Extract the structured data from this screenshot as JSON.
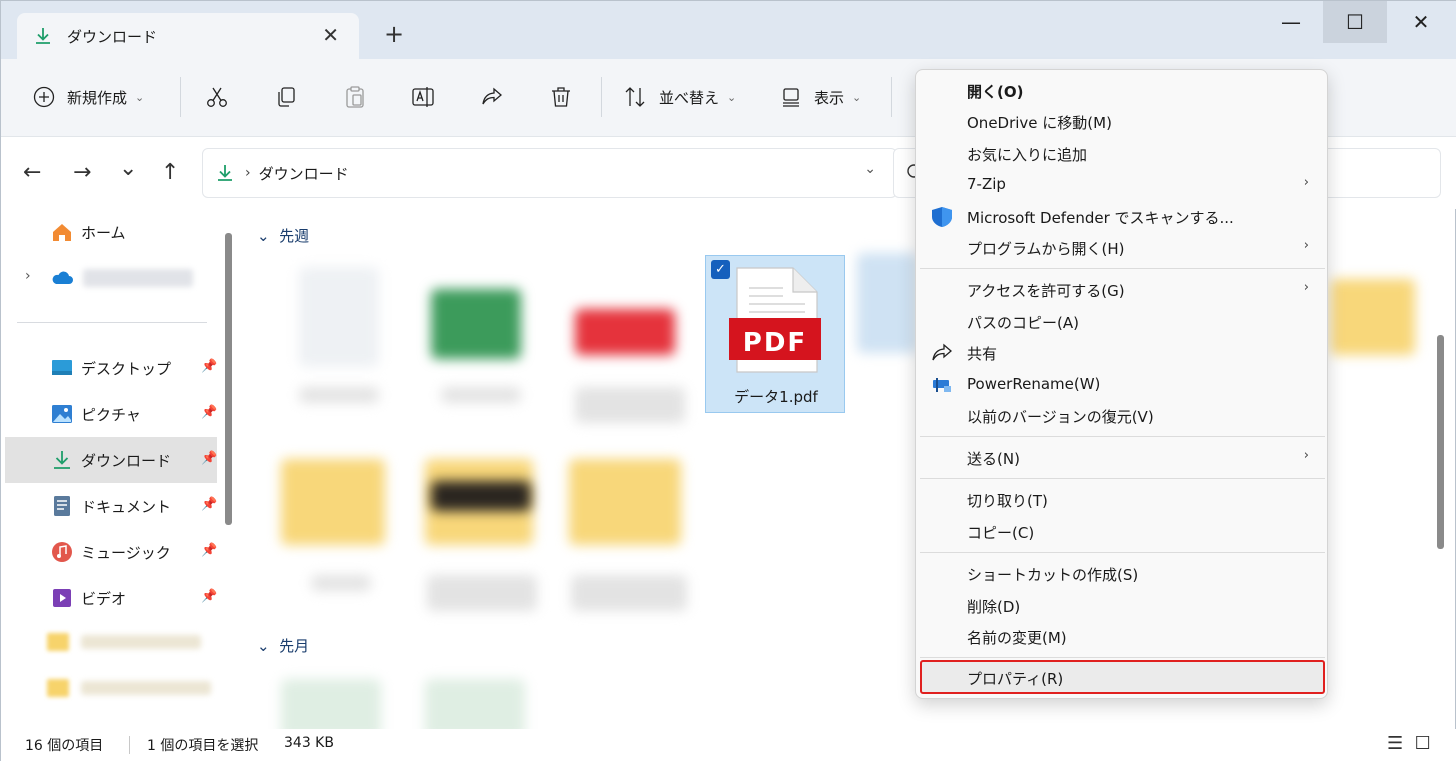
{
  "titlebar": {
    "tab_title": "ダウンロード",
    "tab_close": "✕",
    "new_tab": "+",
    "minimize": "—",
    "maximize": "☐",
    "close": "✕"
  },
  "toolbar": {
    "new_label": "新規作成",
    "sort_label": "並べ替え",
    "view_label": "表示"
  },
  "nav": {
    "back": "←",
    "forward": "→",
    "recent": "⌄",
    "up": "↑",
    "breadcrumb": "ダウンロード"
  },
  "sidebar": {
    "items": [
      {
        "label": "ホーム"
      },
      {
        "label": "デスクトップ"
      },
      {
        "label": "ピクチャ"
      },
      {
        "label": "ダウンロード"
      },
      {
        "label": "ドキュメント"
      },
      {
        "label": "ミュージック"
      },
      {
        "label": "ビデオ"
      }
    ]
  },
  "content": {
    "group_last_week": "先週",
    "group_last_month": "先月",
    "selected_file_name": "データ1.pdf",
    "pdf_badge": "PDF"
  },
  "status": {
    "item_count": "16 個の項目",
    "selected": "1 個の項目を選択",
    "size": "343 KB"
  },
  "context_menu": {
    "items": [
      {
        "label": "開く(O)"
      },
      {
        "label": "OneDrive に移動(M)"
      },
      {
        "label": "お気に入りに追加"
      },
      {
        "label": "7-Zip"
      },
      {
        "label": "Microsoft Defender でスキャンする..."
      },
      {
        "label": "プログラムから開く(H)"
      },
      {
        "label": "アクセスを許可する(G)"
      },
      {
        "label": "パスのコピー(A)"
      },
      {
        "label": "共有"
      },
      {
        "label": "PowerRename(W)"
      },
      {
        "label": "以前のバージョンの復元(V)"
      },
      {
        "label": "送る(N)"
      },
      {
        "label": "切り取り(T)"
      },
      {
        "label": "コピー(C)"
      },
      {
        "label": "ショートカットの作成(S)"
      },
      {
        "label": "削除(D)"
      },
      {
        "label": "名前の変更(M)"
      },
      {
        "label": "プロパティ(R)"
      }
    ],
    "submenu_arrow": "›"
  },
  "colors": {
    "accent": "#1560bd",
    "selection_bg": "#cce4f7",
    "highlight_border": "#e0201f",
    "download_green": "#1e9e6a",
    "pdf_red": "#e0201f"
  }
}
